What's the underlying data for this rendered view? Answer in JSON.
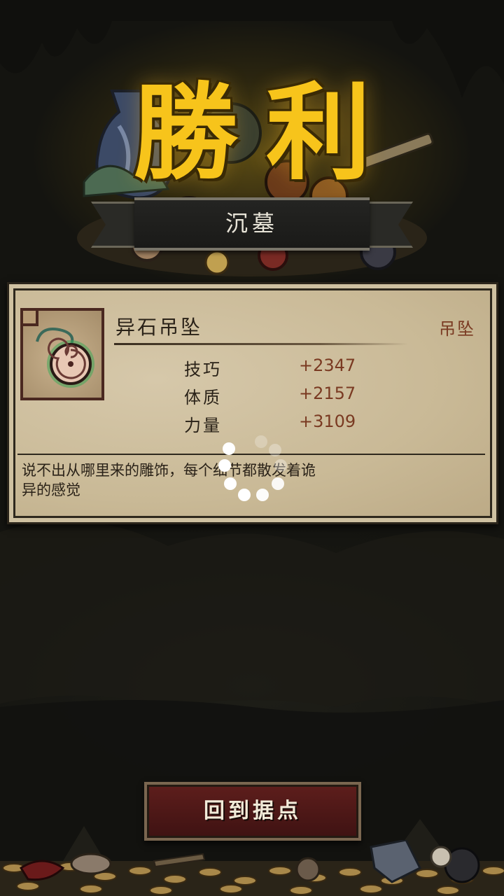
{
  "banner": {
    "title": "勝利",
    "dungeon": "沉墓"
  },
  "item": {
    "name": "异石吊坠",
    "type": "吊坠",
    "icon": "ammonite-pendant-icon",
    "stats": [
      {
        "label": "技巧",
        "value": "+2347"
      },
      {
        "label": "体质",
        "value": "+2157"
      },
      {
        "label": "力量",
        "value": "+3109"
      }
    ],
    "description_line1": "说不出从哪里来的雕饰，每个细节都散发着诡",
    "description_line2": "异的感觉"
  },
  "actions": {
    "return_label": "回到据点"
  },
  "colors": {
    "title_gold": "#f7c41b",
    "parchment": "#c9b996",
    "stat_value": "#7a3a22",
    "button_red": "#5e1e1c"
  }
}
